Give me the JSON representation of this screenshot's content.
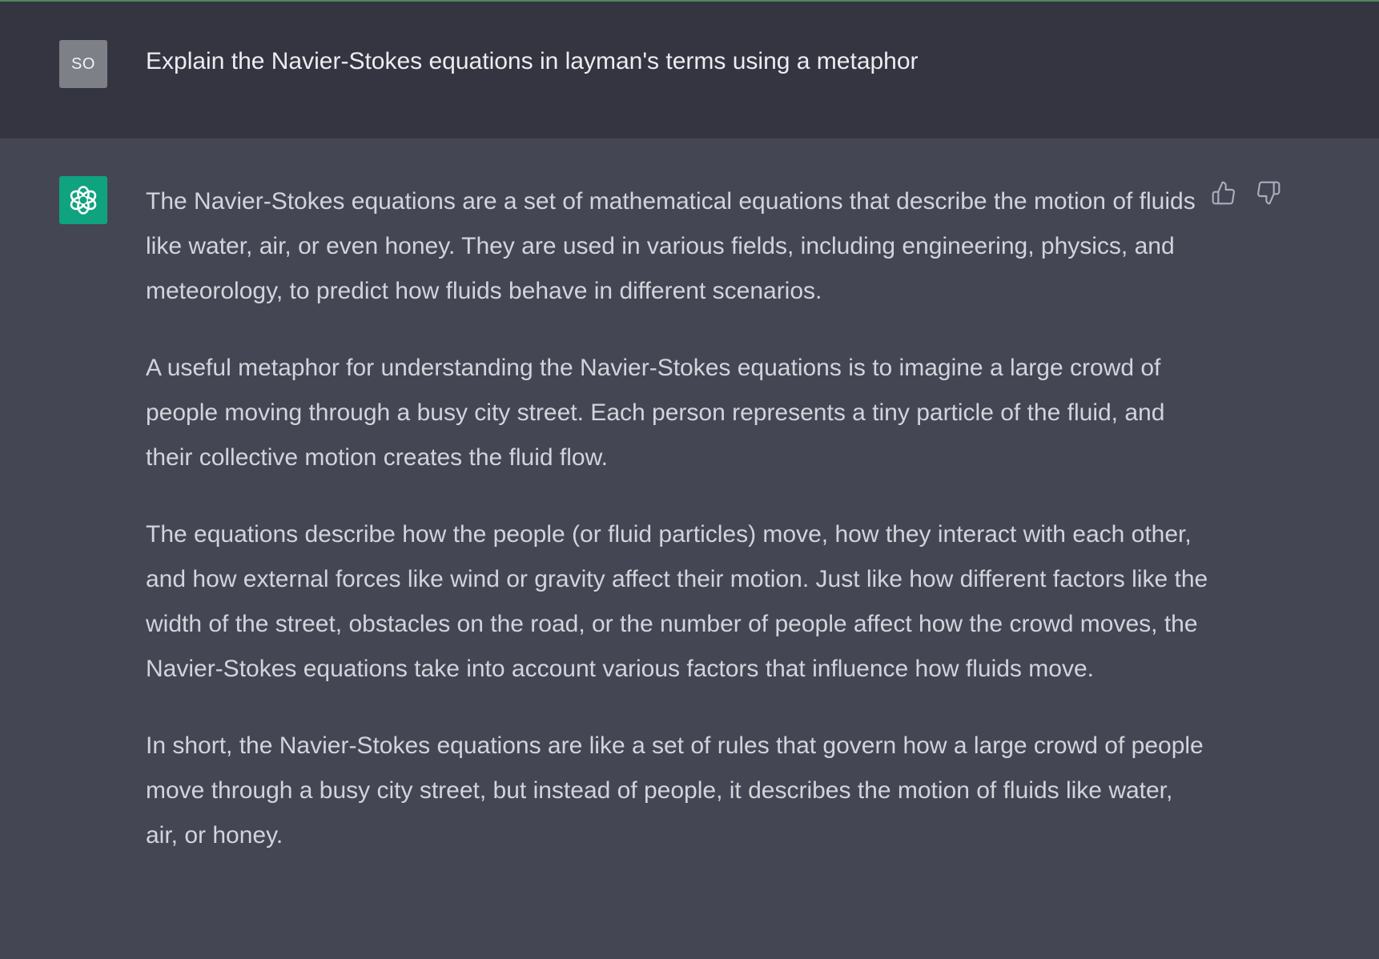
{
  "conversation": {
    "user": {
      "avatar_initials": "SO",
      "message": "Explain the Navier-Stokes equations in layman's terms using a metaphor"
    },
    "assistant": {
      "avatar_icon": "openai-logo-icon",
      "paragraphs": [
        "The Navier-Stokes equations are a set of mathematical equations that describe the motion of fluids like water, air, or even honey. They are used in various fields, including engineering, physics, and meteorology, to predict how fluids behave in different scenarios.",
        "A useful metaphor for understanding the Navier-Stokes equations is to imagine a large crowd of people moving through a busy city street. Each person represents a tiny particle of the fluid, and their collective motion creates the fluid flow.",
        "The equations describe how the people (or fluid particles) move, how they interact with each other, and how external forces like wind or gravity affect their motion. Just like how different factors like the width of the street, obstacles on the road, or the number of people affect how the crowd moves, the Navier-Stokes equations take into account various factors that influence how fluids move.",
        "In short, the Navier-Stokes equations are like a set of rules that govern how a large crowd of people move through a busy city street, but instead of people, it describes the motion of fluids like water, air, or honey."
      ]
    },
    "feedback": {
      "up_icon": "thumbs-up-icon",
      "down_icon": "thumbs-down-icon"
    }
  },
  "colors": {
    "user_bg": "#343541",
    "assistant_bg": "#444654",
    "brand_green": "#10a37f",
    "user_avatar_bg": "#7e8087",
    "text_primary": "#ececf1",
    "text_secondary": "#d1d5db"
  }
}
